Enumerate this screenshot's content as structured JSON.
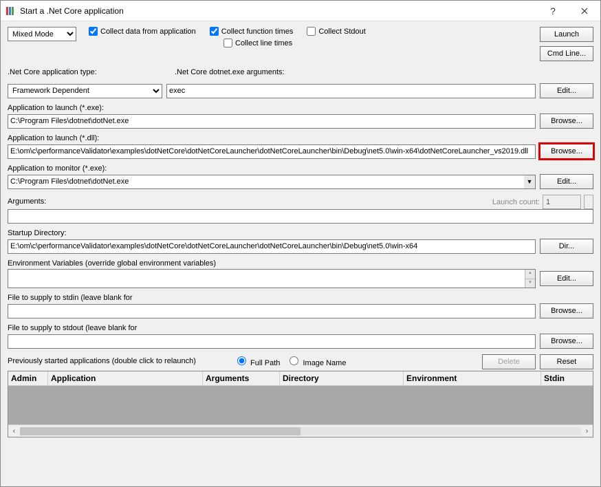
{
  "window": {
    "title": "Start a .Net Core application"
  },
  "modeCombo": "Mixed Mode",
  "checkboxes": {
    "collectDataApp": {
      "label": "Collect data from application",
      "checked": true
    },
    "collectFuncTimes": {
      "label": "Collect function times",
      "checked": true
    },
    "collectStdout": {
      "label": "Collect Stdout",
      "checked": false
    },
    "collectLineTimes": {
      "label": "Collect line times",
      "checked": false
    }
  },
  "buttons": {
    "launch": "Launch",
    "cmdLine": "Cmd Line...",
    "editArgs": "Edit...",
    "browseExe": "Browse...",
    "browseDll": "Browse...",
    "editMonitor": "Edit...",
    "dir": "Dir...",
    "editEnv": "Edit...",
    "browseStdin": "Browse...",
    "browseStdout": "Browse...",
    "delete": "Delete",
    "reset": "Reset"
  },
  "labels": {
    "appType": ".Net Core application type:",
    "dotnetArgs": ".Net Core dotnet.exe arguments:",
    "appLaunchExe": "Application to launch (*.exe):",
    "appLaunchDll": "Application to launch (*.dll):",
    "appMonitor": "Application to monitor (*.exe):",
    "arguments": "Arguments:",
    "launchCount": "Launch count:",
    "startupDir": "Startup Directory:",
    "envVars": "Environment Variables (override global environment variables)",
    "stdin": "File to supply to stdin (leave blank for",
    "stdout": "File to supply to stdout (leave blank for",
    "prevStarted": "Previously started applications (double click to relaunch)",
    "fullPath": "Full Path",
    "imageName": "Image Name"
  },
  "fields": {
    "appType": "Framework Dependent",
    "dotnetArgs": "exec",
    "appLaunchExe": "C:\\Program Files\\dotnet\\dotNet.exe",
    "appLaunchDll": "E:\\om\\c\\performanceValidator\\examples\\dotNetCore\\dotNetCoreLauncher\\dotNetCoreLauncher\\bin\\Debug\\net5.0\\win-x64\\dotNetCoreLauncher_vs2019.dll",
    "appMonitor": "C:\\Program Files\\dotnet\\dotNet.exe",
    "arguments": "",
    "launchCount": "1",
    "startupDir": "E:\\om\\c\\performanceValidator\\examples\\dotNetCore\\dotNetCoreLauncher\\dotNetCoreLauncher\\bin\\Debug\\net5.0\\win-x64",
    "envVars": "",
    "stdin": "",
    "stdout": ""
  },
  "radio": {
    "fullPath": true,
    "imageName": false
  },
  "table": {
    "cols": [
      "Admin",
      "Application",
      "Arguments",
      "Directory",
      "Environment",
      "Stdin"
    ]
  }
}
